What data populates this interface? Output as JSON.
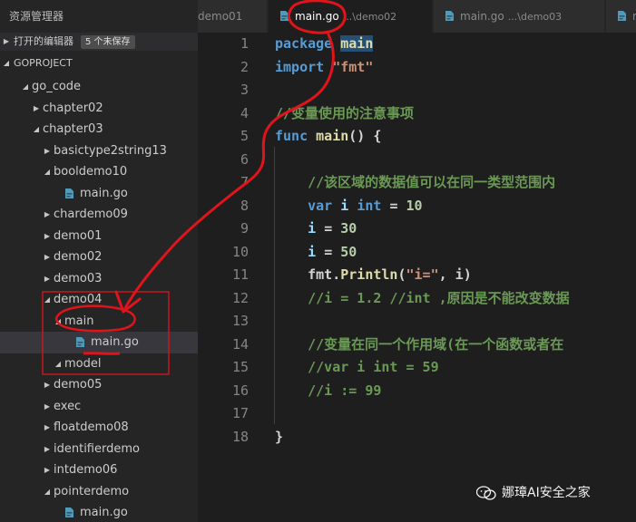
{
  "sidebar": {
    "title": "资源管理器",
    "open_editors_label": "打开的编辑器",
    "unsaved_badge": "5 个未保存",
    "project_label": "GOPROJECT",
    "tree": [
      {
        "label": "go_code",
        "depth": 1,
        "twisty": "open",
        "type": "folder"
      },
      {
        "label": "chapter02",
        "depth": 2,
        "twisty": "closed",
        "type": "folder"
      },
      {
        "label": "chapter03",
        "depth": 2,
        "twisty": "open",
        "type": "folder"
      },
      {
        "label": "basictype2string13",
        "depth": 3,
        "twisty": "closed",
        "type": "folder"
      },
      {
        "label": "booldemo10",
        "depth": 3,
        "twisty": "open",
        "type": "folder"
      },
      {
        "label": "main.go",
        "depth": 4,
        "twisty": "none",
        "type": "file"
      },
      {
        "label": "chardemo09",
        "depth": 3,
        "twisty": "closed",
        "type": "folder"
      },
      {
        "label": "demo01",
        "depth": 3,
        "twisty": "closed",
        "type": "folder"
      },
      {
        "label": "demo02",
        "depth": 3,
        "twisty": "closed",
        "type": "folder"
      },
      {
        "label": "demo03",
        "depth": 3,
        "twisty": "closed",
        "type": "folder"
      },
      {
        "label": "demo04",
        "depth": 3,
        "twisty": "open",
        "type": "folder"
      },
      {
        "label": "main",
        "depth": 4,
        "twisty": "open",
        "type": "folder"
      },
      {
        "label": "main.go",
        "depth": 5,
        "twisty": "none",
        "type": "file",
        "selected": true
      },
      {
        "label": "model",
        "depth": 4,
        "twisty": "open",
        "type": "folder"
      },
      {
        "label": "demo05",
        "depth": 3,
        "twisty": "closed",
        "type": "folder"
      },
      {
        "label": "exec",
        "depth": 3,
        "twisty": "closed",
        "type": "folder"
      },
      {
        "label": "floatdemo08",
        "depth": 3,
        "twisty": "closed",
        "type": "folder"
      },
      {
        "label": "identifierdemo",
        "depth": 3,
        "twisty": "closed",
        "type": "folder"
      },
      {
        "label": "intdemo06",
        "depth": 3,
        "twisty": "closed",
        "type": "folder"
      },
      {
        "label": "pointerdemo",
        "depth": 3,
        "twisty": "open",
        "type": "folder"
      },
      {
        "label": "main.go",
        "depth": 4,
        "twisty": "none",
        "type": "file"
      }
    ]
  },
  "tabs": [
    {
      "name": "demo01",
      "path": "",
      "active": false,
      "icon": false
    },
    {
      "name": "main.go",
      "path": "...\\demo02",
      "active": true,
      "icon": true
    },
    {
      "name": "main.go",
      "path": "...\\demo03",
      "active": false,
      "icon": true
    },
    {
      "name": "ma",
      "path": "",
      "active": false,
      "icon": true
    }
  ],
  "editor": {
    "line_numbers": [
      "1",
      "2",
      "3",
      "4",
      "5",
      "6",
      "7",
      "8",
      "9",
      "10",
      "11",
      "12",
      "13",
      "14",
      "15",
      "16",
      "17",
      "18"
    ],
    "lines": [
      [
        {
          "t": "package ",
          "c": "kw"
        },
        {
          "t": "main",
          "c": "pkgsel"
        }
      ],
      [
        {
          "t": "import ",
          "c": "kw"
        },
        {
          "t": "\"fmt\"",
          "c": "str"
        }
      ],
      [],
      [
        {
          "t": "//变量使用的注意事项",
          "c": "cm"
        }
      ],
      [
        {
          "t": "func ",
          "c": "kw"
        },
        {
          "t": "main",
          "c": "fn"
        },
        {
          "t": "() {",
          "c": ""
        }
      ],
      [],
      [
        {
          "t": "    //该区域的数据值可以在同一类型范围内",
          "c": "cm"
        }
      ],
      [
        {
          "t": "    var ",
          "c": "kw"
        },
        {
          "t": "i ",
          "c": "var"
        },
        {
          "t": "int ",
          "c": "kw"
        },
        {
          "t": "= ",
          "c": ""
        },
        {
          "t": "10",
          "c": "num"
        }
      ],
      [
        {
          "t": "    i ",
          "c": "var"
        },
        {
          "t": "= ",
          "c": ""
        },
        {
          "t": "30",
          "c": "num"
        }
      ],
      [
        {
          "t": "    i ",
          "c": "var"
        },
        {
          "t": "= ",
          "c": ""
        },
        {
          "t": "50",
          "c": "num"
        }
      ],
      [
        {
          "t": "    fmt.",
          "c": ""
        },
        {
          "t": "Println",
          "c": "fn"
        },
        {
          "t": "(",
          "c": ""
        },
        {
          "t": "\"i=\"",
          "c": "str"
        },
        {
          "t": ", i)",
          "c": ""
        }
      ],
      [
        {
          "t": "    //i = 1.2 //int ,原因是不能改变数据",
          "c": "cm"
        }
      ],
      [],
      [
        {
          "t": "    //变量在同一个作用域(在一个函数或者在",
          "c": "cm"
        }
      ],
      [
        {
          "t": "    //var i int = 59",
          "c": "cm"
        }
      ],
      [
        {
          "t": "    //i := 99",
          "c": "cm"
        }
      ],
      [],
      [
        {
          "t": "}",
          "c": ""
        }
      ]
    ]
  },
  "watermark": {
    "text": "娜璋AI安全之家"
  },
  "colors": {
    "annotation": "#e0141a",
    "sidebar_bg": "#252526",
    "editor_bg": "#1e1e1e",
    "selection": "#264f78"
  }
}
